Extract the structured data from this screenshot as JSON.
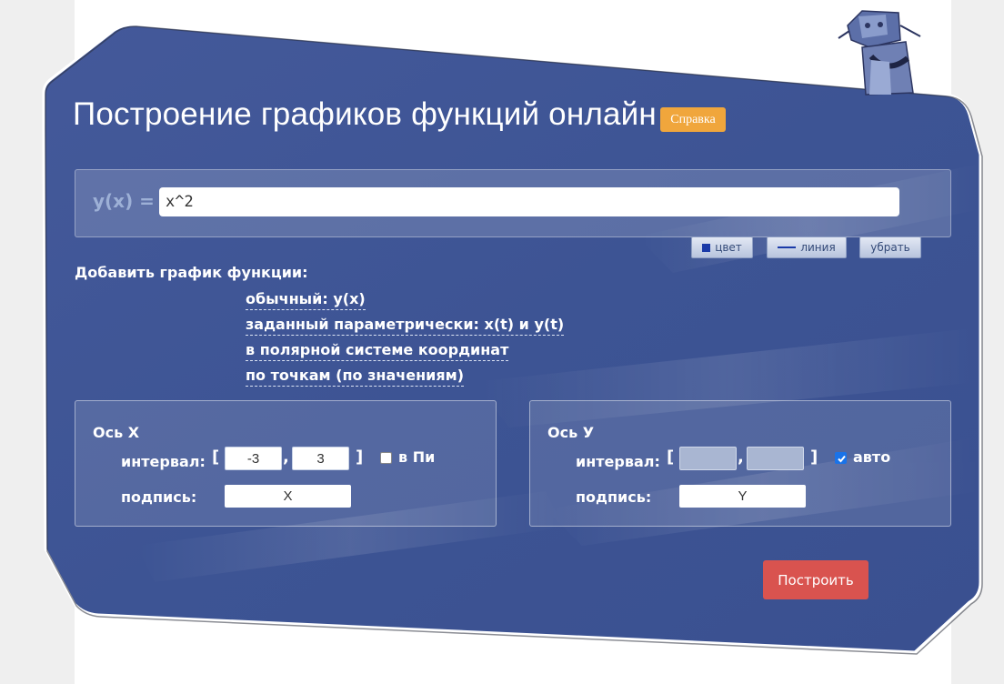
{
  "header": {
    "title": "Построение графиков функций онлайн",
    "help_label": "Справка"
  },
  "function": {
    "label": "y(x) =",
    "value": "x^2"
  },
  "graph_controls": {
    "color_label": "цвет",
    "line_label": "линия",
    "remove_label": "убрать"
  },
  "add_graph": {
    "title": "Добавить график функции:",
    "options": [
      "обычный: y(x)",
      "заданный параметрически: x(t) и y(t)",
      "в полярной системе координат",
      "по точкам (по значениям)"
    ]
  },
  "axis_x": {
    "title": "Ось X",
    "interval_label": "интервал:",
    "min": "-3",
    "max": "3",
    "pi_checked": false,
    "pi_label": "в Пи",
    "caption_label": "подпись:",
    "caption": "X"
  },
  "axis_y": {
    "title": "Ось У",
    "interval_label": "интервал:",
    "min": "",
    "max": "",
    "auto_checked": true,
    "auto_label": "авто",
    "caption_label": "подпись:",
    "caption": "Y"
  },
  "build_label": "Построить",
  "colors": {
    "panel": "#3f5794",
    "accent_badge": "#f0a63c",
    "build_button": "#d9534f",
    "checkbox": "#1a73e8"
  }
}
